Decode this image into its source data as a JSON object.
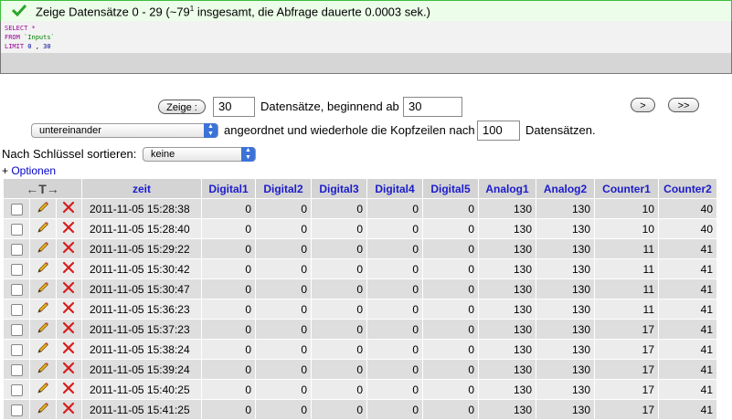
{
  "status": {
    "prefix": "Zeige Datensätze 0 - 29 (~79",
    "footnote": "1",
    "suffix": " insgesamt, die Abfrage dauerte 0.0003 sek.)"
  },
  "sql": {
    "line1_kw": "SELECT",
    "line1_rest": " *",
    "line2_kw": "FROM",
    "line2_rest": " `Inputs`",
    "line3_kw": "LIMIT",
    "line3_a": " 0",
    "line3_sep": " , ",
    "line3_b": "30"
  },
  "nav": {
    "show_button": "Zeige :",
    "rows_count": "30",
    "records_label": "Datensätze, beginnend ab",
    "start_from": "30",
    "next_button": ">",
    "last_button": ">>",
    "mode_select": "untereinander",
    "repeat_label": "angeordnet und wiederhole die Kopfzeilen nach",
    "repeat_value": "100",
    "repeat_suffix": "Datensätzen."
  },
  "sort": {
    "label": "Nach Schlüssel sortieren:",
    "value": "keine"
  },
  "options": {
    "prefix": "+ ",
    "link": "Optionen"
  },
  "table": {
    "expand_arrows": "←T→",
    "columns": [
      "zeit",
      "Digital1",
      "Digital2",
      "Digital3",
      "Digital4",
      "Digital5",
      "Analog1",
      "Analog2",
      "Counter1",
      "Counter2"
    ],
    "rows": [
      [
        "2011-11-05 15:28:38",
        "0",
        "0",
        "0",
        "0",
        "0",
        "130",
        "130",
        "10",
        "40"
      ],
      [
        "2011-11-05 15:28:40",
        "0",
        "0",
        "0",
        "0",
        "0",
        "130",
        "130",
        "10",
        "40"
      ],
      [
        "2011-11-05 15:29:22",
        "0",
        "0",
        "0",
        "0",
        "0",
        "130",
        "130",
        "11",
        "41"
      ],
      [
        "2011-11-05 15:30:42",
        "0",
        "0",
        "0",
        "0",
        "0",
        "130",
        "130",
        "11",
        "41"
      ],
      [
        "2011-11-05 15:30:47",
        "0",
        "0",
        "0",
        "0",
        "0",
        "130",
        "130",
        "11",
        "41"
      ],
      [
        "2011-11-05 15:36:23",
        "0",
        "0",
        "0",
        "0",
        "0",
        "130",
        "130",
        "11",
        "41"
      ],
      [
        "2011-11-05 15:37:23",
        "0",
        "0",
        "0",
        "0",
        "0",
        "130",
        "130",
        "17",
        "41"
      ],
      [
        "2011-11-05 15:38:24",
        "0",
        "0",
        "0",
        "0",
        "0",
        "130",
        "130",
        "17",
        "41"
      ],
      [
        "2011-11-05 15:39:24",
        "0",
        "0",
        "0",
        "0",
        "0",
        "130",
        "130",
        "17",
        "41"
      ],
      [
        "2011-11-05 15:40:25",
        "0",
        "0",
        "0",
        "0",
        "0",
        "130",
        "130",
        "17",
        "41"
      ],
      [
        "2011-11-05 15:41:25",
        "0",
        "0",
        "0",
        "0",
        "0",
        "130",
        "130",
        "17",
        "41"
      ]
    ]
  }
}
